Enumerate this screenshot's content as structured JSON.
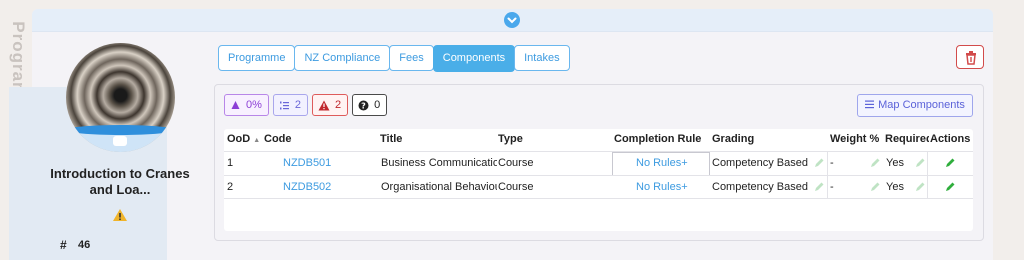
{
  "sidebar_label": "Programme",
  "course": {
    "title": "Introduction to Cranes and Loa...",
    "hash": "#",
    "count": "46"
  },
  "tabs": [
    {
      "label": "Programme",
      "active": false
    },
    {
      "label": "NZ Compliance",
      "active": false
    },
    {
      "label": "Fees",
      "active": false
    },
    {
      "label": "Components",
      "active": true
    },
    {
      "label": "Intakes",
      "active": false
    }
  ],
  "badges": {
    "purple": "0%",
    "blue": "2",
    "red": "2",
    "dark": "0"
  },
  "map_button": "Map Components",
  "table": {
    "headers": {
      "ood": "OoD",
      "code": "Code",
      "title": "Title",
      "type": "Type",
      "completion": "Completion Rule",
      "grading": "Grading",
      "weight": "Weight %",
      "required": "Required",
      "actions": "Actions"
    },
    "rows": [
      {
        "ood": "1",
        "code": "NZDB501",
        "title": "Business Communication",
        "type": "Course",
        "completion": "No Rules+",
        "grading": "Competency Based",
        "weight": "-",
        "required": "Yes"
      },
      {
        "ood": "2",
        "code": "NZDB502",
        "title": "Organisational Behaviour",
        "type": "Course",
        "completion": "No Rules+",
        "grading": "Competency Based",
        "weight": "-",
        "required": "Yes"
      }
    ]
  },
  "colors": {
    "accent": "#4aaee8",
    "danger": "#d24b4b",
    "edit_green": "#2fae3c"
  }
}
